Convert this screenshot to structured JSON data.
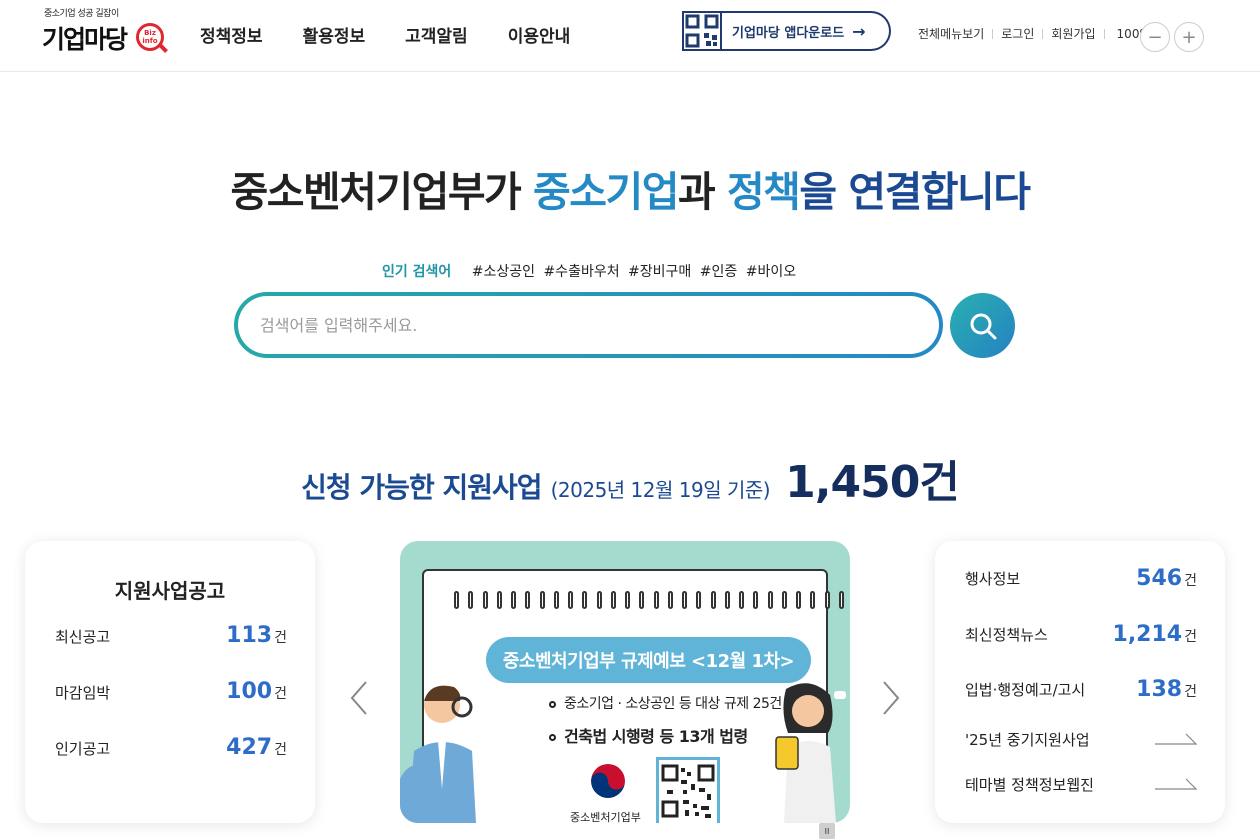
{
  "header": {
    "logo_tagline": "중소기업 성공 길잡이",
    "logo_text": "기업마당",
    "logo_badge": "Biz info",
    "nav": [
      "정책정보",
      "활용정보",
      "고객알림",
      "이용안내"
    ],
    "app_download": "기업마당 앱다운로드",
    "util_links": [
      "전체메뉴보기",
      "로그인",
      "회원가입"
    ],
    "zoom_level": "100%",
    "zoom_out": "−",
    "zoom_in": "+"
  },
  "hero": {
    "title_part1": "중소벤처기업부가 ",
    "title_part2": "중소기업",
    "title_part3": "과 ",
    "title_part4": "정책",
    "title_part5": "을 연결합니다"
  },
  "popular": {
    "label": "인기 검색어",
    "tags": [
      "#소상공인",
      "#수출바우처",
      "#장비구매",
      "#인증",
      "#바이오"
    ]
  },
  "search": {
    "placeholder": "검색어를 입력해주세요.",
    "value": ""
  },
  "count": {
    "label": "신청 가능한 지원사업",
    "date": "(2025년 12월 19일 기준)",
    "number": "1,450건"
  },
  "left_card": {
    "title": "지원사업공고",
    "rows": [
      {
        "label": "최신공고",
        "value": "113",
        "unit": "건"
      },
      {
        "label": "마감임박",
        "value": "100",
        "unit": "건"
      },
      {
        "label": "인기공고",
        "value": "427",
        "unit": "건"
      }
    ]
  },
  "banner": {
    "title": "중소벤처기업부 규제예보 <12월 1차>",
    "line1": "중소기업 · 소상공인 등 대상 규제 25건",
    "line2": "건축법 시행령 등 13개 법령",
    "ministry": "중소벤처기업부",
    "pause": "II"
  },
  "right_card": {
    "rows": [
      {
        "label": "행사정보",
        "value": "546",
        "unit": "건"
      },
      {
        "label": "최신정책뉴스",
        "value": "1,214",
        "unit": "건"
      },
      {
        "label": "입법·행정예고/고시",
        "value": "138",
        "unit": "건"
      },
      {
        "label": "'25년 중기지원사업",
        "value": "",
        "unit": ""
      },
      {
        "label": "테마별 정책정보웹진",
        "value": "",
        "unit": ""
      }
    ]
  },
  "colors": {
    "accent_teal": "#2196a8",
    "accent_blue": "#2489c4",
    "navy": "#1c4a92",
    "stat_blue": "#2d6cc7"
  }
}
